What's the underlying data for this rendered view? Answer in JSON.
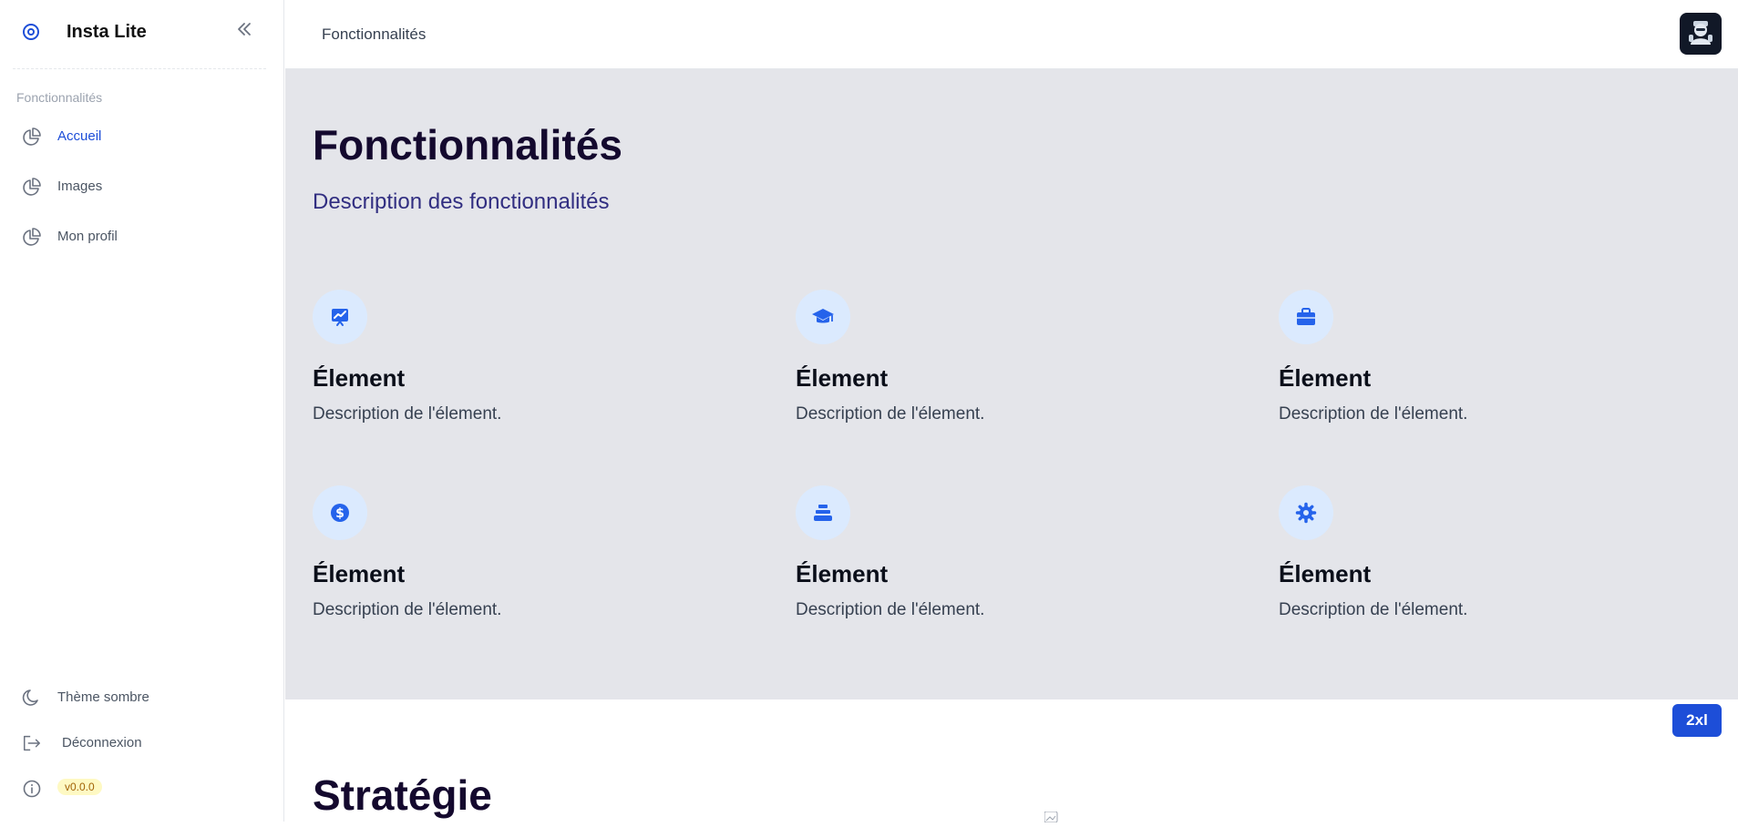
{
  "app": {
    "name": "Insta Lite",
    "brand_icon": "target-icon",
    "collapse_icon": "chevrons-left-icon",
    "accent": "#1d4ed8"
  },
  "sidebar": {
    "section_label": "Fonctionnalités",
    "items": [
      {
        "label": "Accueil",
        "icon": "pie-chart-icon",
        "active": true
      },
      {
        "label": "Images",
        "icon": "pie-chart-icon",
        "active": false
      },
      {
        "label": "Mon profil",
        "icon": "pie-chart-icon",
        "active": false
      }
    ],
    "bottom": {
      "theme_label": "Thème sombre",
      "logout_label": "Déconnexion",
      "version": "v0.0.0"
    }
  },
  "topbar": {
    "title": "Fonctionnalités",
    "avatar_icon": "robot-avatar-icon"
  },
  "features": {
    "title": "Fonctionnalités",
    "subtitle": "Description des fonctionnalités",
    "items": [
      {
        "icon": "presentation-chart-icon",
        "title": "Élement",
        "description": "Description de l'élement."
      },
      {
        "icon": "graduation-cap-icon",
        "title": "Élement",
        "description": "Description de l'élement."
      },
      {
        "icon": "briefcase-icon",
        "title": "Élement",
        "description": "Description de l'élement."
      },
      {
        "icon": "dollar-circle-icon",
        "title": "Élement",
        "description": "Description de l'élement."
      },
      {
        "icon": "stack-icon",
        "title": "Élement",
        "description": "Description de l'élement."
      },
      {
        "icon": "gear-icon",
        "title": "Élement",
        "description": "Description de l'élement."
      }
    ]
  },
  "breakpoint_badge": "2xl",
  "strategy": {
    "title": "Stratégie"
  }
}
